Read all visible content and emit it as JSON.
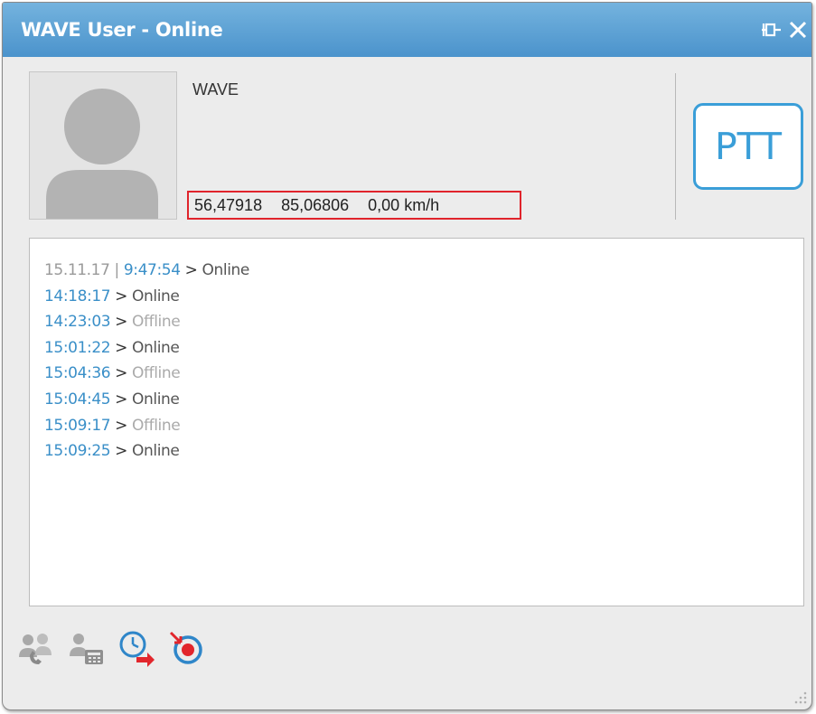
{
  "window": {
    "title": "WAVE User - Online",
    "pin_icon": "pin-icon",
    "close_icon": "close-icon",
    "accent_color": "#4b93cc"
  },
  "user": {
    "name": "WAVE",
    "avatar_icon": "user-avatar-icon",
    "latitude": "56,47918",
    "longitude": "85,06806",
    "speed": "0,00 km/h"
  },
  "ptt": {
    "label": "PTT",
    "color": "#3a9ed8"
  },
  "log": {
    "date": "15.11.17",
    "date_separator": "|",
    "entries": [
      {
        "time": "9:47:54",
        "arrow": ">",
        "status": "Online"
      },
      {
        "time": "14:18:17",
        "arrow": ">",
        "status": "Online"
      },
      {
        "time": "14:23:03",
        "arrow": ">",
        "status": "Offline"
      },
      {
        "time": "15:01:22",
        "arrow": ">",
        "status": "Online"
      },
      {
        "time": "15:04:36",
        "arrow": ">",
        "status": "Offline"
      },
      {
        "time": "15:04:45",
        "arrow": ">",
        "status": "Online"
      },
      {
        "time": "15:09:17",
        "arrow": ">",
        "status": "Offline"
      },
      {
        "time": "15:09:25",
        "arrow": ">",
        "status": "Online"
      }
    ]
  },
  "toolbar": {
    "icons": [
      "group-call-icon",
      "phone-call-icon",
      "location-history-icon",
      "track-location-icon"
    ]
  }
}
